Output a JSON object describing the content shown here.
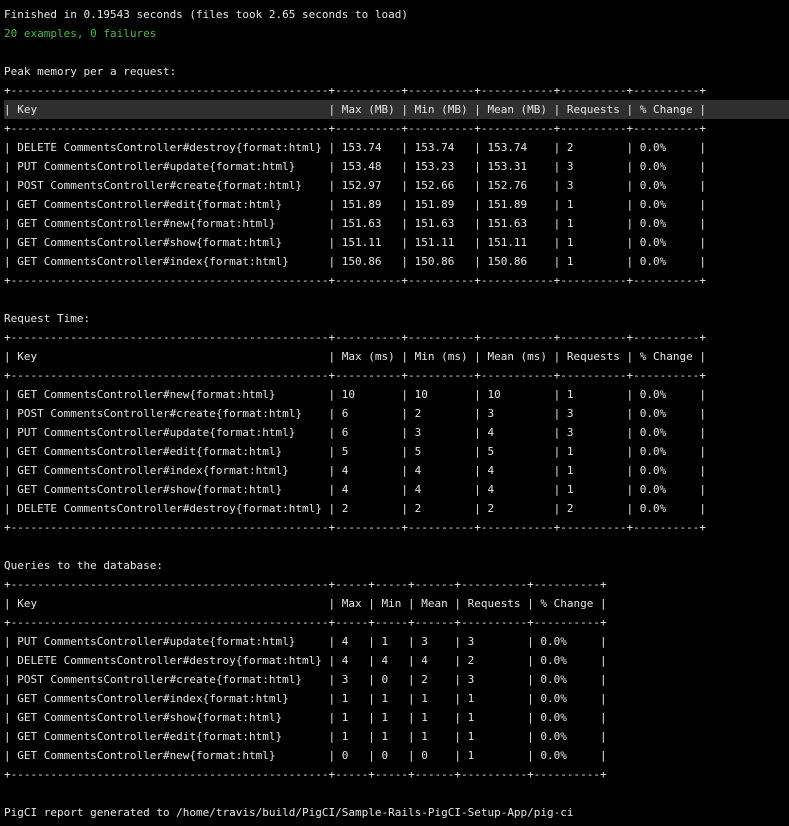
{
  "summary": {
    "finished": "Finished in 0.19543 seconds (files took 2.65 seconds to load)",
    "result": "20 examples, 0 failures",
    "result_color": "#4bb84b",
    "highlight_color": "#2f2f2f"
  },
  "memory": {
    "title": "Peak memory per a request:",
    "border": "+------------------------------------------------+----------+----------+-----------+----------+----------+",
    "header": "| Key                                            | Max (MB) | Min (MB) | Mean (MB) | Requests | % Change |",
    "rows": [
      "| DELETE CommentsController#destroy{format:html} | 153.74   | 153.74   | 153.74    | 2        | 0.0%     |",
      "| PUT CommentsController#update{format:html}     | 153.48   | 153.23   | 153.31    | 3        | 0.0%     |",
      "| POST CommentsController#create{format:html}    | 152.97   | 152.66   | 152.76    | 3        | 0.0%     |",
      "| GET CommentsController#edit{format:html}       | 151.89   | 151.89   | 151.89    | 1        | 0.0%     |",
      "| GET CommentsController#new{format:html}        | 151.63   | 151.63   | 151.63    | 1        | 0.0%     |",
      "| GET CommentsController#show{format:html}       | 151.11   | 151.11   | 151.11    | 1        | 0.0%     |",
      "| GET CommentsController#index{format:html}      | 150.86   | 150.86   | 150.86    | 1        | 0.0%     |"
    ]
  },
  "request_time": {
    "title": "Request Time:",
    "border": "+------------------------------------------------+----------+----------+-----------+----------+----------+",
    "header": "| Key                                            | Max (ms) | Min (ms) | Mean (ms) | Requests | % Change |",
    "rows": [
      "| GET CommentsController#new{format:html}        | 10       | 10       | 10        | 1        | 0.0%     |",
      "| POST CommentsController#create{format:html}    | 6        | 2        | 3         | 3        | 0.0%     |",
      "| PUT CommentsController#update{format:html}     | 6        | 3        | 4         | 3        | 0.0%     |",
      "| GET CommentsController#edit{format:html}       | 5        | 5        | 5         | 1        | 0.0%     |",
      "| GET CommentsController#index{format:html}      | 4        | 4        | 4         | 1        | 0.0%     |",
      "| GET CommentsController#show{format:html}       | 4        | 4        | 4         | 1        | 0.0%     |",
      "| DELETE CommentsController#destroy{format:html} | 2        | 2        | 2         | 2        | 0.0%     |"
    ]
  },
  "queries": {
    "title": "Queries to the database:",
    "border": "+------------------------------------------------+-----+-----+------+----------+----------+",
    "header": "| Key                                            | Max | Min | Mean | Requests | % Change |",
    "rows": [
      "| PUT CommentsController#update{format:html}     | 4   | 1   | 3    | 3        | 0.0%     |",
      "| DELETE CommentsController#destroy{format:html} | 4   | 4   | 4    | 2        | 0.0%     |",
      "| POST CommentsController#create{format:html}    | 3   | 0   | 2    | 3        | 0.0%     |",
      "| GET CommentsController#index{format:html}      | 1   | 1   | 1    | 1        | 0.0%     |",
      "| GET CommentsController#show{format:html}       | 1   | 1   | 1    | 1        | 0.0%     |",
      "| GET CommentsController#edit{format:html}       | 1   | 1   | 1    | 1        | 0.0%     |",
      "| GET CommentsController#new{format:html}        | 0   | 0   | 0    | 1        | 0.0%     |"
    ]
  },
  "footer": "PigCI report generated to /home/travis/build/PigCI/Sample-Rails-PigCI-Setup-App/pig-ci"
}
